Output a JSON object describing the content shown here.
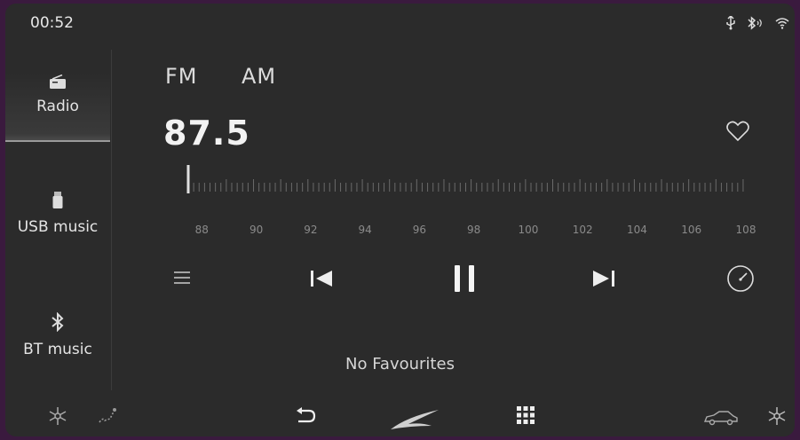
{
  "status": {
    "time": "00:52",
    "icons": [
      "usb-icon",
      "bluetooth-icon",
      "wifi-icon"
    ]
  },
  "sidebar": {
    "items": [
      {
        "label": "Radio",
        "icon": "radio-icon",
        "active": true
      },
      {
        "label": "USB music",
        "icon": "usb-drive-icon",
        "active": false
      },
      {
        "label": "BT music",
        "icon": "bluetooth-icon",
        "active": false
      }
    ]
  },
  "bands": {
    "fm": "FM",
    "am": "AM",
    "selected": "FM"
  },
  "frequency": "87.5",
  "tuner": {
    "min": 87.5,
    "max": 108,
    "current": 87.5,
    "scale_labels": [
      "88",
      "90",
      "92",
      "94",
      "96",
      "98",
      "100",
      "102",
      "104",
      "106",
      "108"
    ]
  },
  "controls": [
    "list-icon",
    "previous-icon",
    "pause-icon",
    "next-icon",
    "scan-gauge-icon"
  ],
  "favourites": {
    "empty_text": "No Favourites"
  },
  "bottom_bar": [
    "climate-left-icon",
    "seat-icon",
    "back-icon",
    "home-logo-icon",
    "apps-grid-icon",
    "car-icon",
    "climate-right-icon"
  ],
  "colors": {
    "background": "#2b2b2b",
    "frame": "#3a1a3e",
    "text": "#e6e6e6",
    "muted": "#8a8a8a"
  }
}
